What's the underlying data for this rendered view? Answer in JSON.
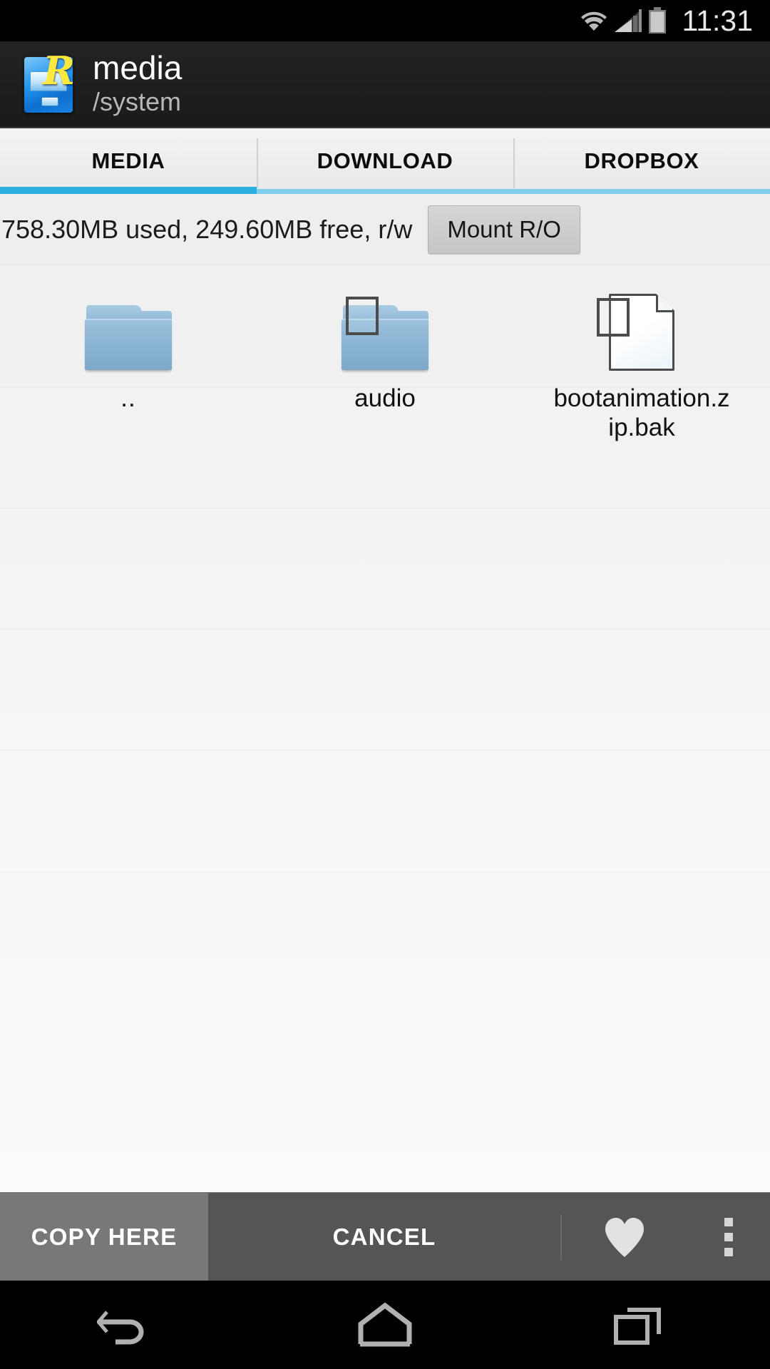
{
  "statusbar": {
    "time": "11:31",
    "icons": [
      "wifi-icon",
      "cell-signal-icon",
      "battery-icon"
    ]
  },
  "actionbar": {
    "app_icon": "root-explorer-icon",
    "title": "media",
    "subtitle": "/system"
  },
  "tabs": {
    "items": [
      {
        "label": "MEDIA",
        "active": true
      },
      {
        "label": "DOWNLOAD",
        "active": false
      },
      {
        "label": "DROPBOX",
        "active": false
      }
    ],
    "accent_color": "#2aaee0",
    "accent_color_inactive": "#7fcdeb"
  },
  "storage": {
    "info": "758.30MB used, 249.60MB free, r/w",
    "used": "758.30MB",
    "free": "249.60MB",
    "mode": "r/w",
    "mount_button": "Mount R/O"
  },
  "files": {
    "columns": 3,
    "items": [
      {
        "name": "..",
        "type": "folder-parent",
        "icon": "folder-icon",
        "checkbox": false,
        "has_checkbox": false
      },
      {
        "name": "audio",
        "type": "folder",
        "icon": "folder-icon",
        "checkbox": false,
        "has_checkbox": true
      },
      {
        "name": "bootanimation.zip.bak",
        "type": "file",
        "icon": "document-icon",
        "checkbox": false,
        "has_checkbox": true
      }
    ]
  },
  "bottombar": {
    "copy_label": "COPY HERE",
    "cancel_label": "CANCEL",
    "favorite_icon": "heart-icon",
    "overflow_icon": "overflow-menu-icon",
    "copy_bg": "#787878",
    "bar_bg": "#555555"
  },
  "navbar": {
    "back": "back-icon",
    "home": "home-icon",
    "recents": "recents-icon"
  }
}
